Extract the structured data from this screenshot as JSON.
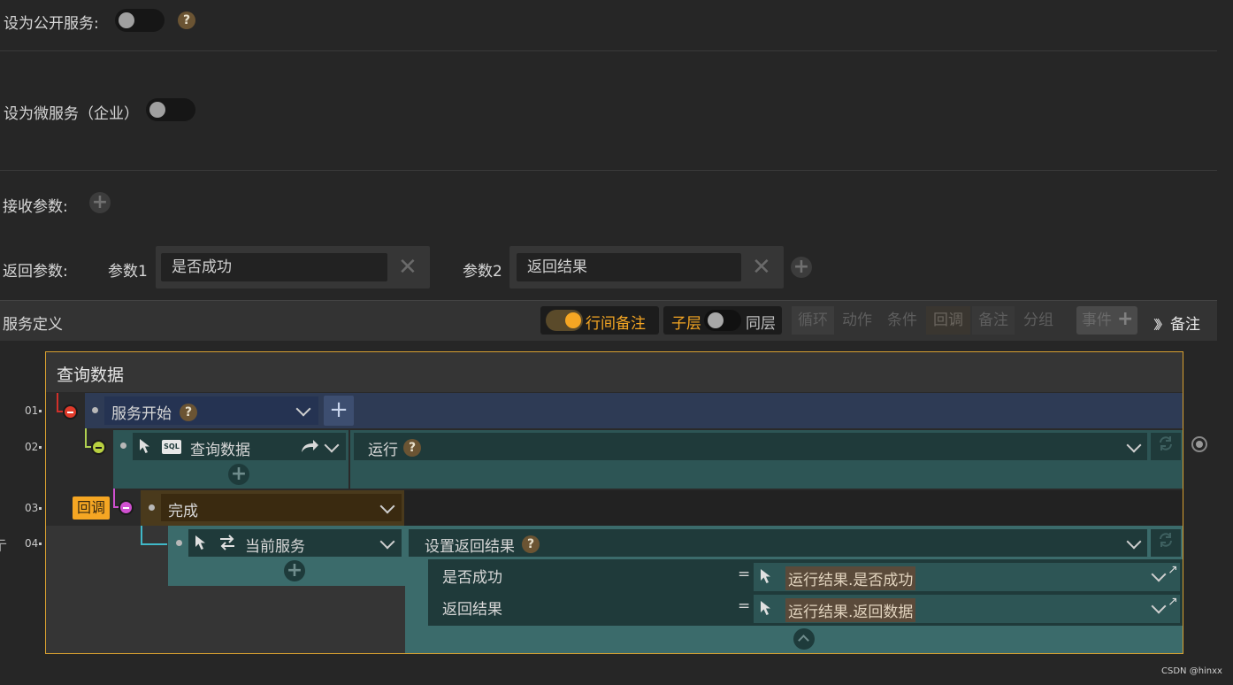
{
  "settings": {
    "public_service_label": "设为公开服务:",
    "micro_service_label": "设为微服务（企业）",
    "receive_params_label": "接收参数:",
    "return_params_label": "返回参数:",
    "param1_label": "参数1",
    "param1_value": "是否成功",
    "param2_label": "参数2",
    "param2_value": "返回结果",
    "help_mark": "?"
  },
  "toolbar": {
    "section_title": "服务定义",
    "line_comment": "行间备注",
    "child_layer": "子层",
    "same_layer": "同层",
    "loop": "循环",
    "action": "动作",
    "condition": "条件",
    "callback": "回调",
    "comment": "备注",
    "group": "分组",
    "event": "事件",
    "comment_right": "备注",
    "comment_chevrons": "〉〉〉"
  },
  "flow": {
    "title": "查询数据",
    "row_numbers": [
      "01",
      "02",
      "03",
      "04"
    ],
    "row1": {
      "node": "服务开始",
      "help": "?"
    },
    "row2": {
      "node": "查询数据",
      "sql_badge": "SQL",
      "action": "运行",
      "help": "?"
    },
    "row3": {
      "tag": "回调",
      "node": "完成"
    },
    "row4": {
      "node": "当前服务",
      "action": "设置返回结果",
      "help": "?",
      "assignments": [
        {
          "name": "是否成功",
          "eq": "=",
          "value": "运行结果.是否成功"
        },
        {
          "name": "返回结果",
          "eq": "=",
          "value": "运行结果.返回数据"
        }
      ]
    },
    "left_edge_glyph": "亍"
  },
  "watermark": "CSDN @hinxx",
  "colors": {
    "accent_orange": "#f5a623",
    "row1_bg": "#2e3b55",
    "row2_bg": "#2d5555",
    "row3_bg": "#4a3a1c",
    "row4_bg": "#3b6b6b",
    "frame_border": "#d8a030"
  }
}
